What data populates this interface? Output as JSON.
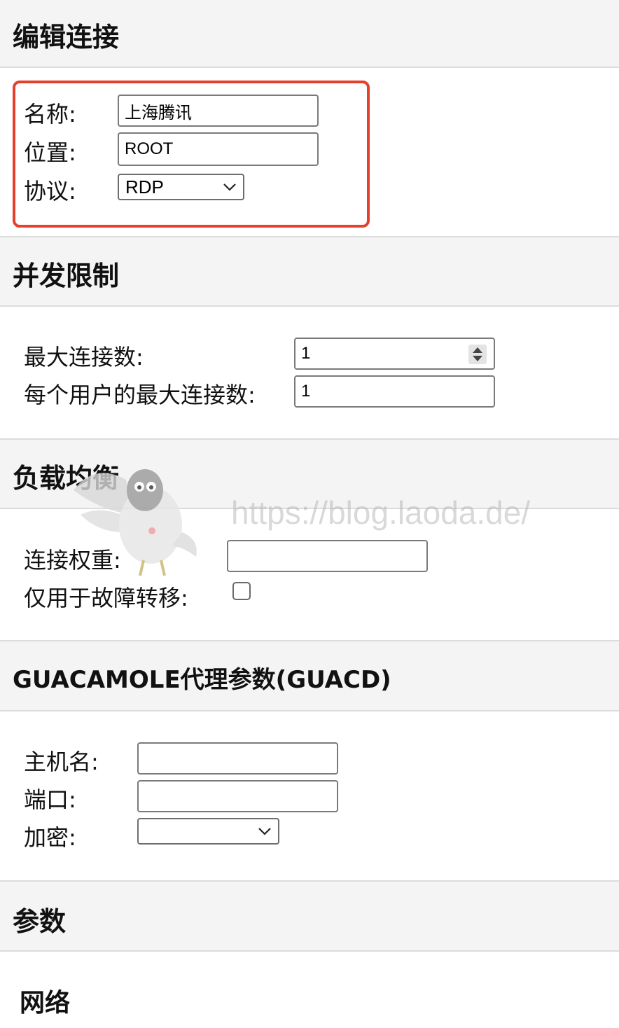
{
  "sections": {
    "edit": {
      "title": "编辑连接"
    },
    "concurrency": {
      "title": "并发限制"
    },
    "load_balancing": {
      "title": "负载均衡"
    },
    "guacd": {
      "title": "GUACAMOLE代理参数(GUACD)"
    },
    "parameters": {
      "title": "参数"
    }
  },
  "edit_connection": {
    "name_label": "名称:",
    "name_value": "上海腾讯",
    "location_label": "位置:",
    "location_value": "ROOT",
    "protocol_label": "协议:",
    "protocol_value": "RDP"
  },
  "concurrency_limits": {
    "max_connections_label": "最大连接数:",
    "max_connections_value": "1",
    "max_per_user_label": "每个用户的最大连接数:",
    "max_per_user_value": "1"
  },
  "load_balancing_fields": {
    "weight_label": "连接权重:",
    "weight_value": "",
    "failover_label": "仅用于故障转移:",
    "failover_checked": false
  },
  "guacd_fields": {
    "hostname_label": "主机名:",
    "hostname_value": "",
    "port_label": "端口:",
    "port_value": "",
    "encryption_label": "加密:",
    "encryption_value": ""
  },
  "network": {
    "title": "网络"
  },
  "watermark": {
    "text": "https://blog.laoda.de/"
  },
  "colors": {
    "highlight": "#e5402b",
    "section_bg": "#f4f4f4",
    "border": "#dcdcdc"
  }
}
